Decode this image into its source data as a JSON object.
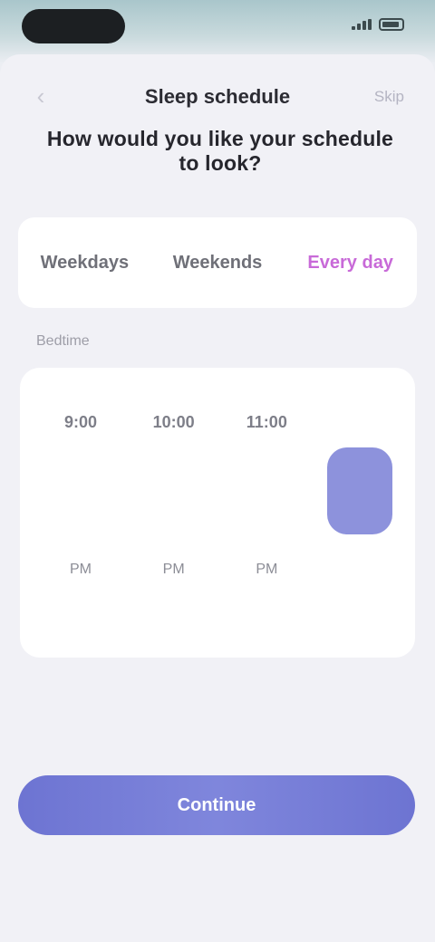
{
  "status_bar": {
    "time": "",
    "icons": [
      "signal-icon",
      "battery-icon"
    ]
  },
  "nav": {
    "back_icon": "chevron-left-icon",
    "title": "Sleep schedule",
    "action": "Skip"
  },
  "question": "How would you like your schedule to look?",
  "segments": [
    {
      "label": "Weekdays",
      "active": false
    },
    {
      "label": "Weekends",
      "active": false
    },
    {
      "label": "Every day",
      "active": true
    }
  ],
  "section_label": "Bedtime",
  "options": [
    {
      "label": "9:00",
      "sub": "PM",
      "selected": false
    },
    {
      "label": "10:00",
      "sub": "PM",
      "selected": false
    },
    {
      "label": "11:00",
      "sub": "PM",
      "selected": false
    },
    {
      "label": "",
      "sub": "",
      "selected": true
    }
  ],
  "cta": {
    "label": "Continue"
  },
  "colors": {
    "accent": "#8d92dc",
    "active_segment": "#c86ad8",
    "button": "#6d74d2"
  }
}
